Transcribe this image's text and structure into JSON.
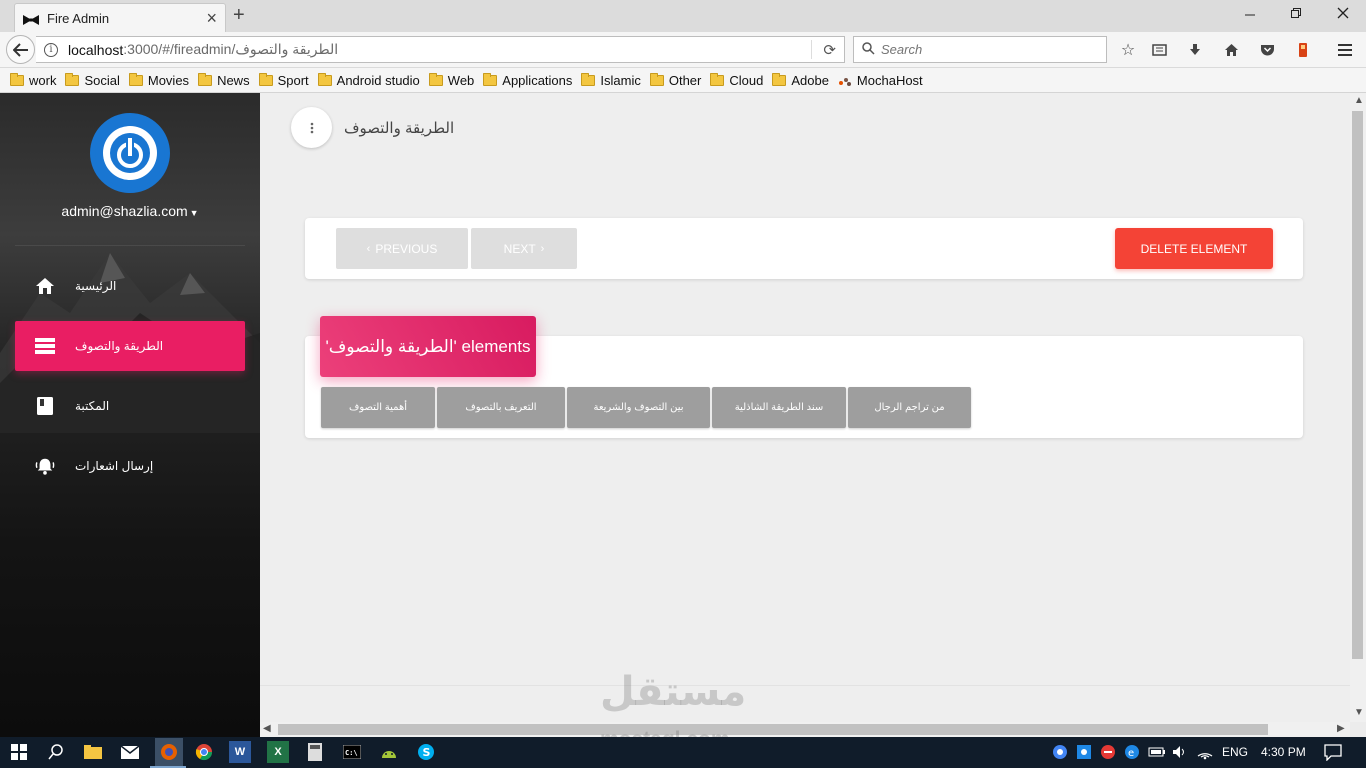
{
  "browser": {
    "tab_title": "Fire Admin",
    "url_host": "localhost",
    "url_path": ":3000/#/fireadmin/الطريقة والتصوف",
    "search_placeholder": "Search",
    "bookmarks": [
      "work",
      "Social",
      "Movies",
      "News",
      "Sport",
      "Android studio",
      "Web",
      "Applications",
      "Islamic",
      "Other",
      "Cloud",
      "Adobe",
      "MochaHost"
    ]
  },
  "sidebar": {
    "email": "admin@shazlia.com",
    "items": [
      {
        "label": "الرئيسية",
        "icon": "home-icon",
        "active": false
      },
      {
        "label": "الطريقة والتصوف",
        "icon": "list-icon",
        "active": true
      },
      {
        "label": "المكتبة",
        "icon": "book-icon",
        "active": false
      },
      {
        "label": "إرسال اشعارات",
        "icon": "bell-icon",
        "active": false
      }
    ]
  },
  "main": {
    "page_title": "الطريقة والتصوف",
    "prev_label": "PREVIOUS",
    "next_label": "NEXT",
    "delete_label": "DELETE ELEMENT",
    "elements_header": "'الطريقة والتصوف' elements",
    "chips": [
      "أهمية التصوف",
      "التعريف بالتصوف",
      "بين التصوف والشريعة",
      "سند الطريقة الشاذلية",
      "من تراجم الرجال"
    ]
  },
  "watermark": {
    "arabic": "مستقل",
    "latin": "mostaql.com"
  },
  "taskbar": {
    "language": "ENG",
    "time": "4:30 PM"
  },
  "colors": {
    "accent": "#e91e63",
    "danger": "#f44336",
    "logo_blue": "#1976d2",
    "chip_gray": "#9e9e9e"
  }
}
